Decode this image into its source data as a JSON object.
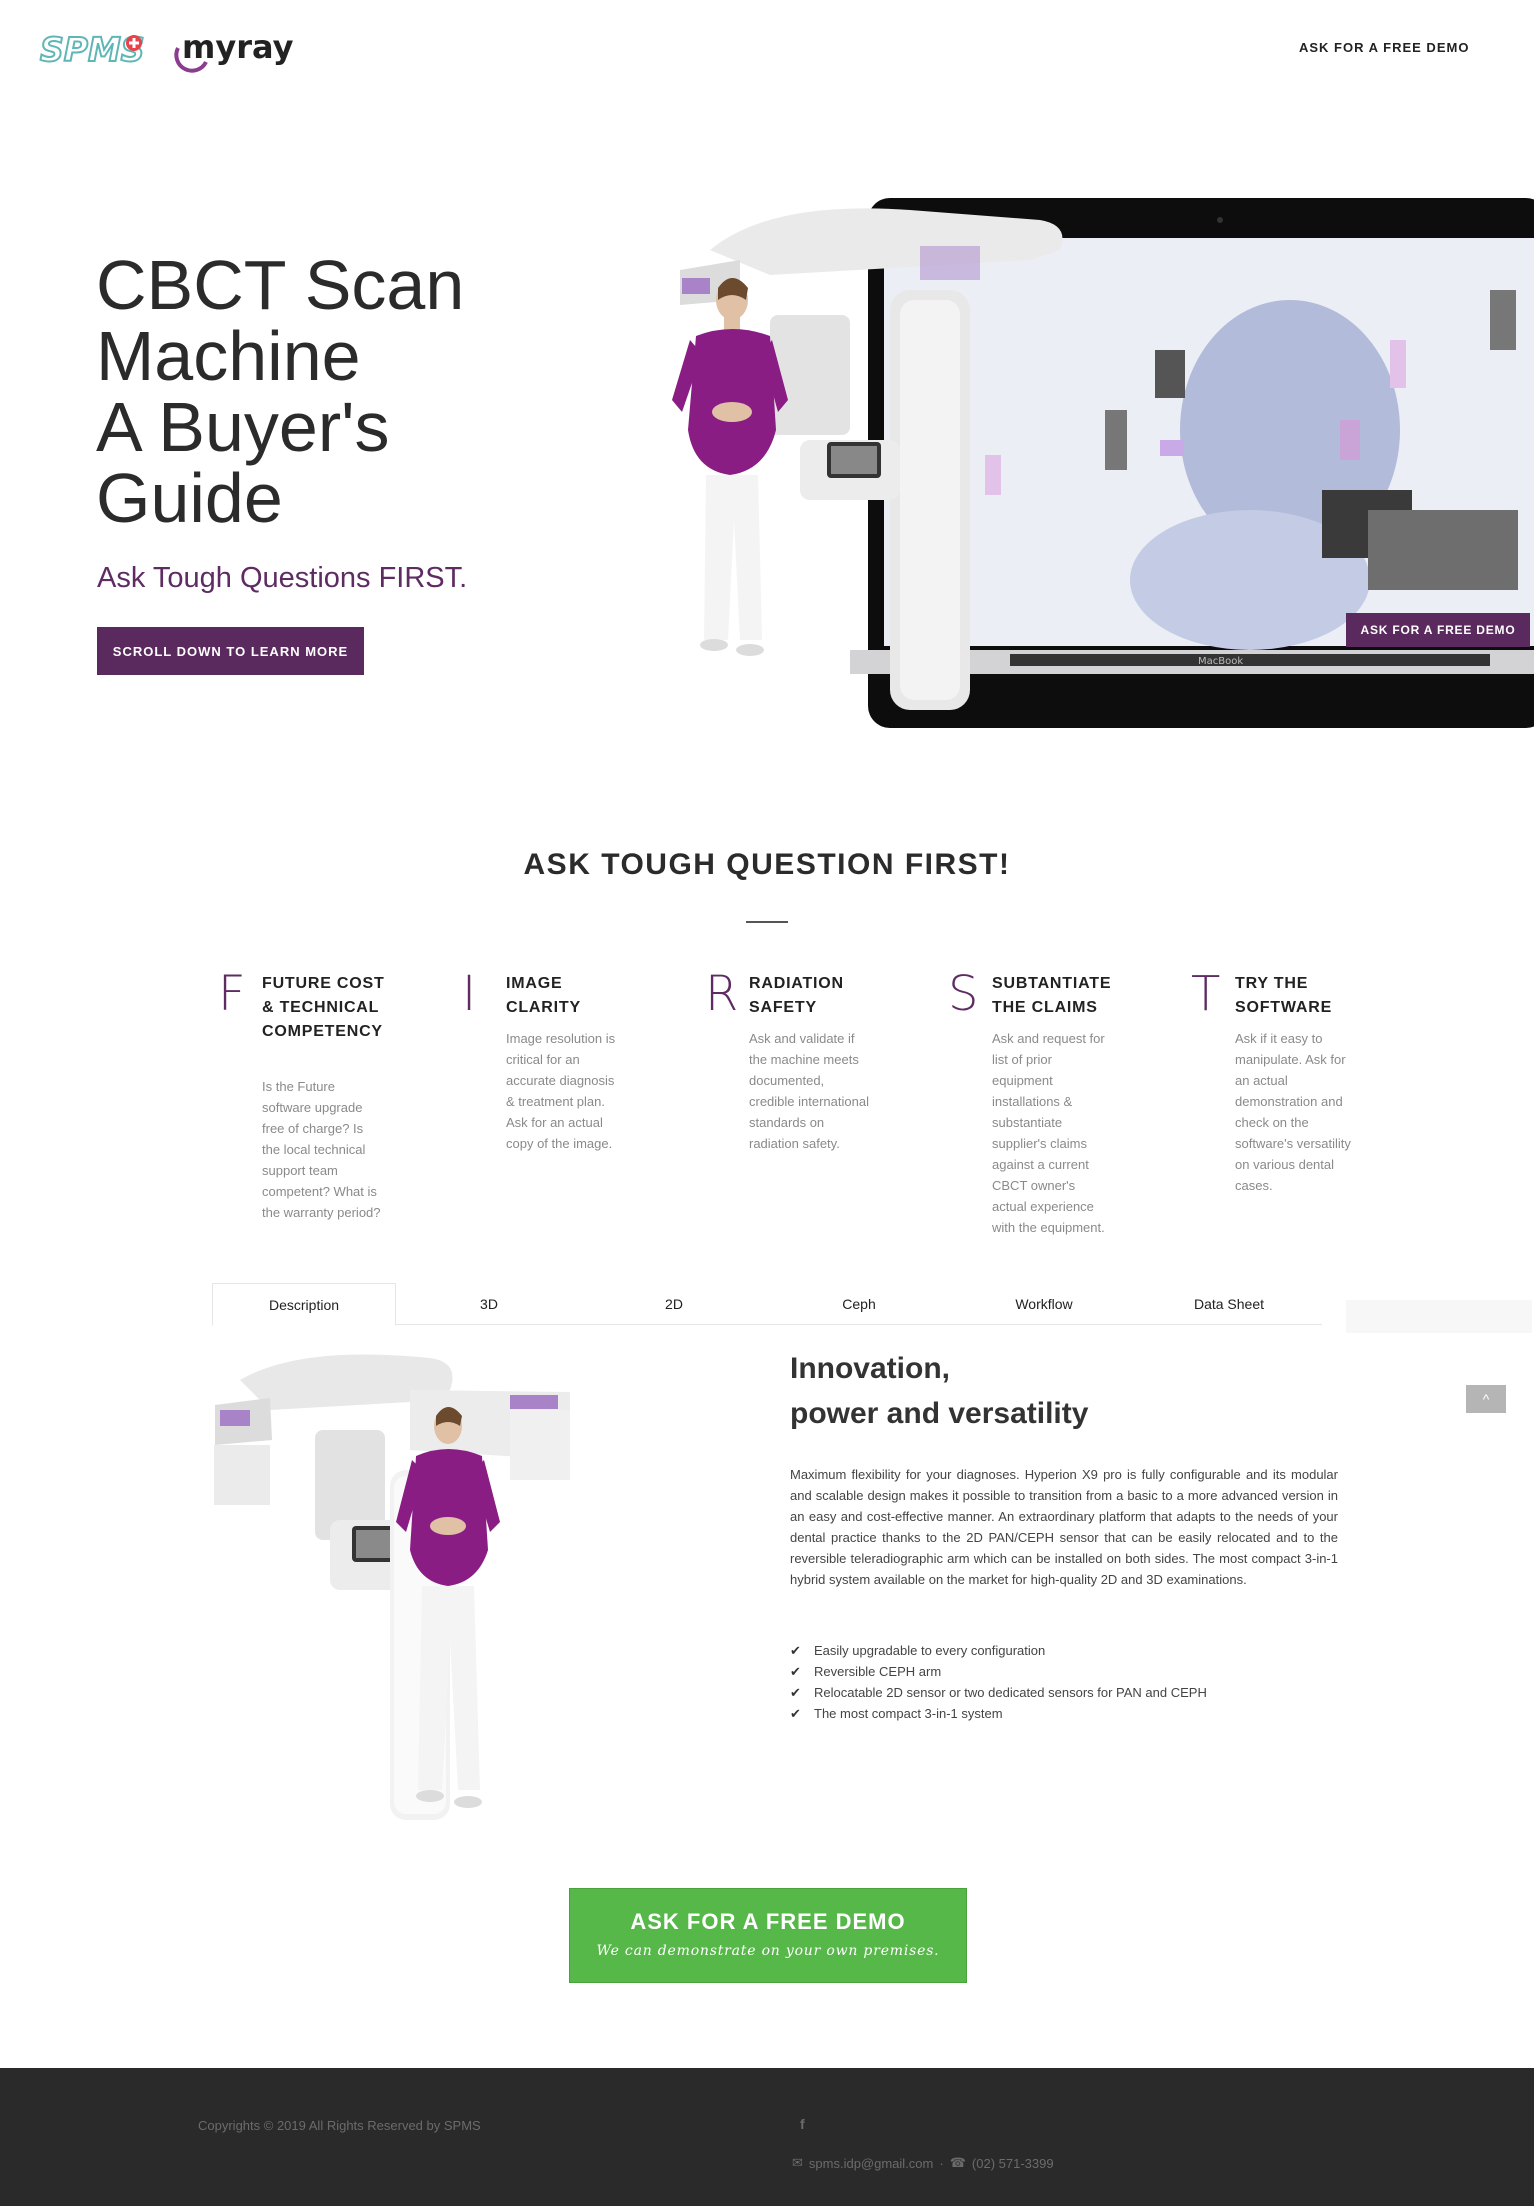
{
  "header": {
    "logo_spms": "SPMS",
    "logo_myray": "myray",
    "nav_demo": "ASK FOR A FREE DEMO"
  },
  "hero": {
    "title_lines": [
      "CBCT Scan",
      "Machine",
      "A Buyer's",
      "Guide"
    ],
    "subtitle": "Ask Tough Questions FIRST.",
    "button": "SCROLL DOWN TO LEARN MORE",
    "laptop_button": "ASK FOR A FREE DEMO",
    "laptop_brand": "MacBook"
  },
  "first": {
    "title": "ASK TOUGH QUESTION FIRST!",
    "items": [
      {
        "letter": "F",
        "heading": "FUTURE COST & TECHNICAL COMPETENCY",
        "text": "Is the Future software upgrade free of charge? Is the local technical support team competent? What is the warranty period?"
      },
      {
        "letter": "I",
        "heading": "IMAGE CLARITY",
        "text": "Image resolution is critical for an accurate diagnosis & treatment plan. Ask for an actual copy of the image."
      },
      {
        "letter": "R",
        "heading": "RADIATION SAFETY",
        "text": "Ask and validate if the machine meets documented, credible international standards on radiation safety."
      },
      {
        "letter": "S",
        "heading": "SUBTANTIATE THE CLAIMS",
        "text": "Ask and request for list of prior equipment installations & substantiate supplier's claims against a current CBCT owner's actual experience with the equipment."
      },
      {
        "letter": "T",
        "heading": "TRY THE SOFTWARE",
        "text": "Ask if it easy to manipulate. Ask for an actual demonstration and check on the software's versatility on various dental cases."
      }
    ]
  },
  "tabs": [
    "Description",
    "3D",
    "2D",
    "Ceph",
    "Workflow",
    "Data Sheet"
  ],
  "active_tab": "Description",
  "floating": {
    "ghost_demo": "ASK FOR A FREE DEMO",
    "scroll_top": "^"
  },
  "description": {
    "title_lines": [
      "Innovation,",
      "power and versatility"
    ],
    "body": "Maximum flexibility for your diagnoses. Hyperion X9 pro is fully configurable and its modular and scalable design makes it possible to transition from a basic to a more advanced version in an easy and cost-effective manner. An extraordinary platform that adapts to the needs of your dental practice thanks to the 2D PAN/CEPH sensor that can be easily relocated and to the reversible teleradiographic arm which can be installed on both sides. The most compact 3-in-1 hybrid system available on the market for high-quality 2D and 3D examinations.",
    "features": [
      "Easily upgradable to every configuration",
      "Reversible CEPH arm",
      "Relocatable 2D sensor or two dedicated sensors for PAN and CEPH",
      "The most compact 3-in-1 system"
    ]
  },
  "cta": {
    "main": "ASK FOR A FREE DEMO",
    "sub": "We can demonstrate on your own premises."
  },
  "footer": {
    "copyright": "Copyrights © 2019 All Rights Reserved by SPMS",
    "facebook": "f",
    "email": "spms.idp@gmail.com",
    "separator": "·",
    "phone": "(02) 571-3399"
  },
  "colors": {
    "brand_purple": "#5a2a5e",
    "cta_green": "#56b848",
    "footer_bg": "#2a2a2a"
  }
}
